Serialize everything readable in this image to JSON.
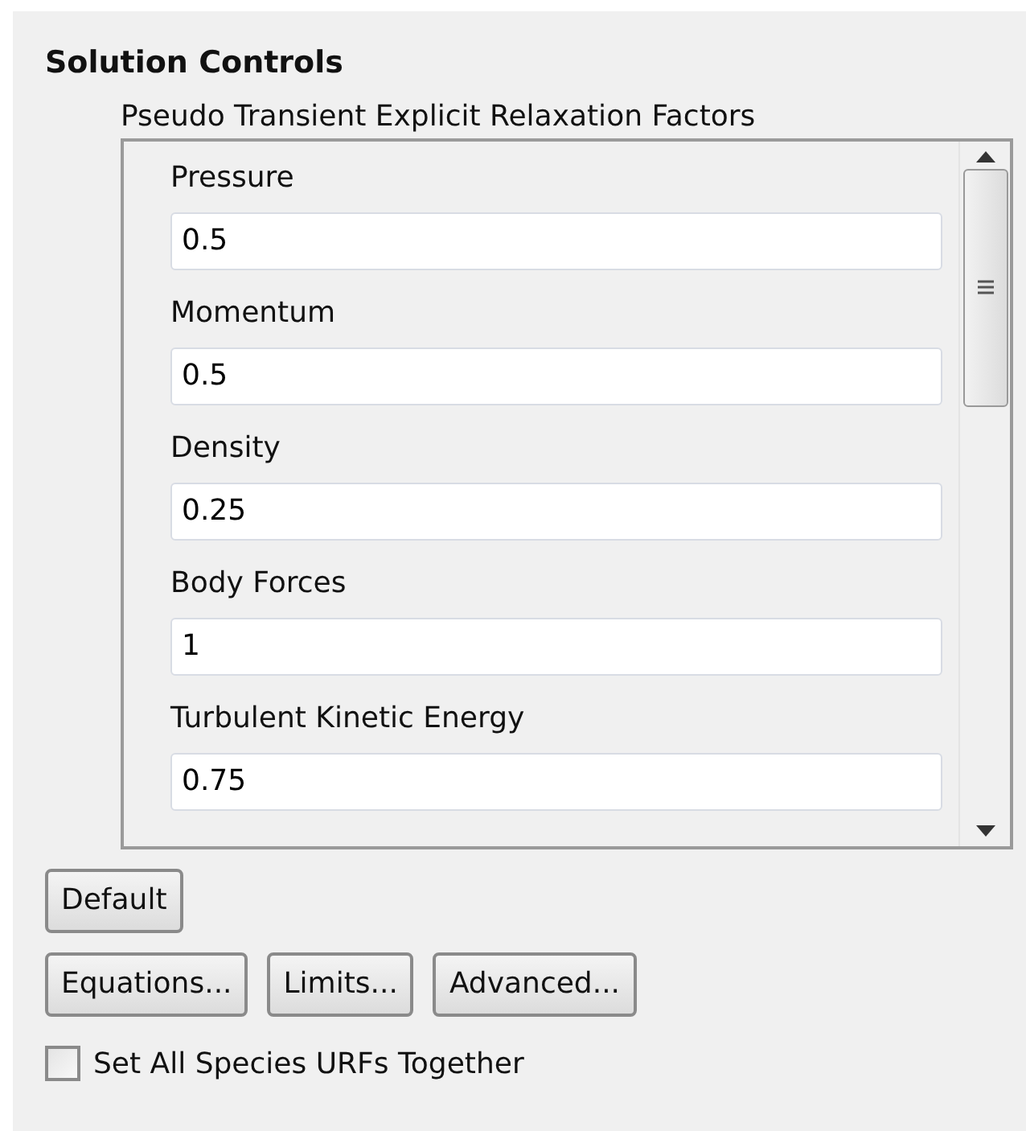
{
  "title": "Solution Controls",
  "group": {
    "label": "Pseudo Transient Explicit Relaxation Factors",
    "fields": [
      {
        "label": "Pressure",
        "value": "0.5"
      },
      {
        "label": "Momentum",
        "value": "0.5"
      },
      {
        "label": "Density",
        "value": "0.25"
      },
      {
        "label": "Body Forces",
        "value": "1"
      },
      {
        "label": "Turbulent Kinetic Energy",
        "value": "0.75"
      }
    ]
  },
  "buttons": [
    [
      "Default"
    ],
    [
      "Equations...",
      "Limits...",
      "Advanced..."
    ]
  ],
  "checkbox": {
    "label": "Set All Species URFs Together",
    "checked": false
  }
}
